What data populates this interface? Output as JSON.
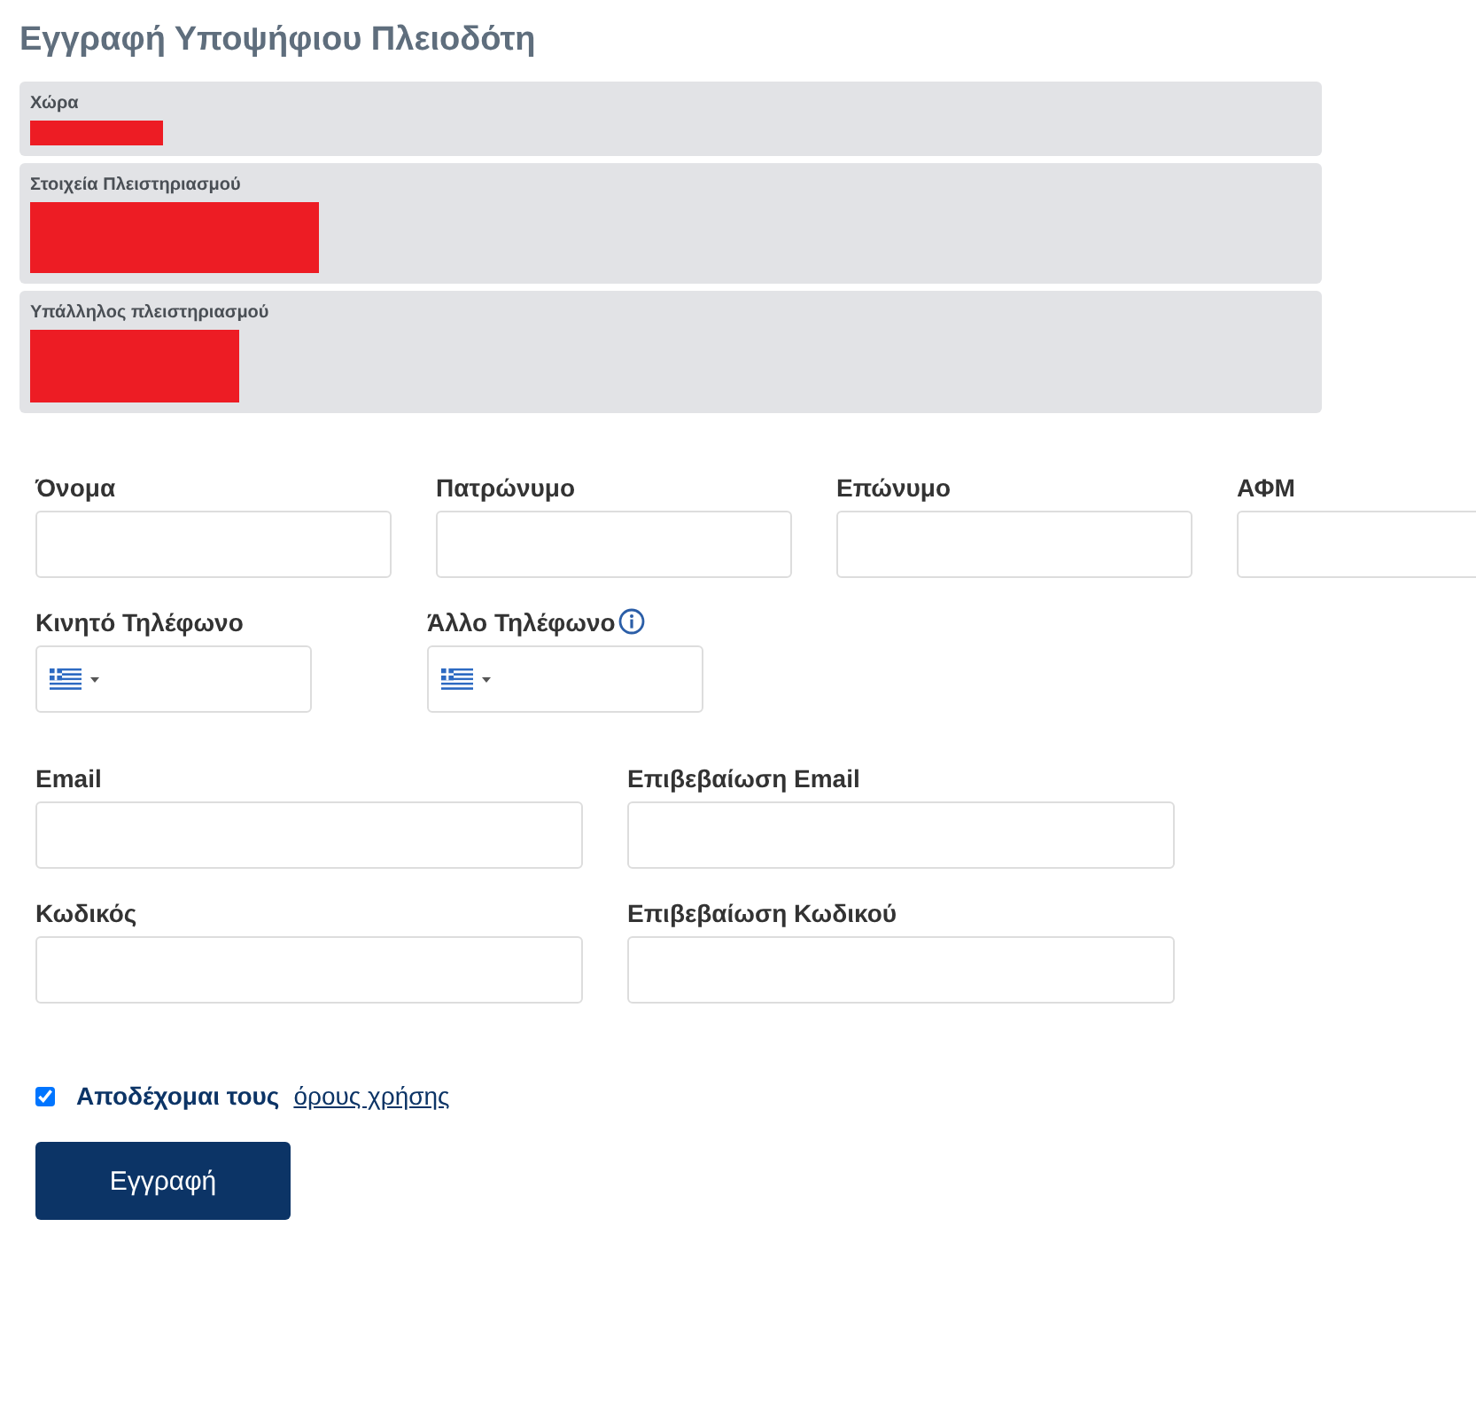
{
  "title": "Εγγραφή Υποψήφιου Πλειοδότη",
  "info_rows": [
    {
      "label": "Χώρα",
      "redacted": true
    },
    {
      "label": "Στοιχεία Πλειστηριασμού",
      "redacted": true
    },
    {
      "label": "Υπάλληλος πλειστηριασμού",
      "redacted": true
    }
  ],
  "name_fields": [
    {
      "label": "Όνομα"
    },
    {
      "label": "Πατρώνυμο"
    },
    {
      "label": "Επώνυμο"
    },
    {
      "label": "ΑΦΜ"
    }
  ],
  "phone_fields": [
    {
      "label": "Κινητό Τηλέφωνο",
      "info": false
    },
    {
      "label": "Άλλο Τηλέφωνο",
      "info": true
    }
  ],
  "account_fields": [
    {
      "label": "Email"
    },
    {
      "label": "Επιβεβαίωση Email"
    },
    {
      "label": "Κωδικός"
    },
    {
      "label": "Επιβεβαίωση Κωδικού"
    }
  ],
  "terms": {
    "checked": true,
    "text": "Αποδέχομαι τους",
    "link": "όρους χρήσης"
  },
  "submit": "Εγγραφή"
}
